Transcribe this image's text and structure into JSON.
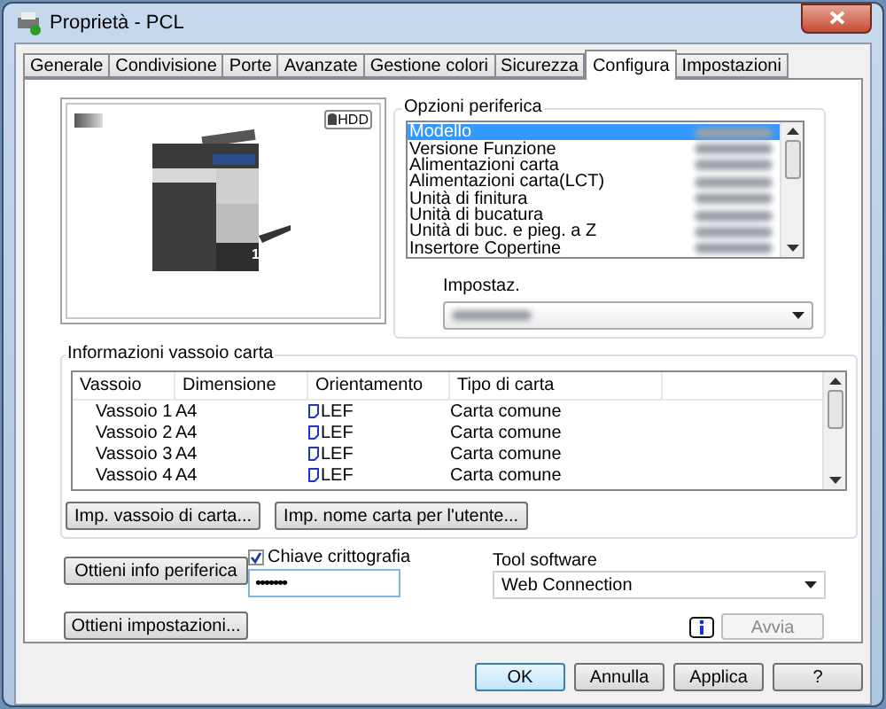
{
  "window": {
    "title": "Proprietà - PCL"
  },
  "tabs": [
    {
      "label": "Generale",
      "selected": false
    },
    {
      "label": "Condivisione",
      "selected": false
    },
    {
      "label": "Porte",
      "selected": false
    },
    {
      "label": "Avanzate",
      "selected": false
    },
    {
      "label": "Gestione colori",
      "selected": false
    },
    {
      "label": "Sicurezza",
      "selected": false
    },
    {
      "label": "Configura",
      "selected": true
    },
    {
      "label": "Impostazioni",
      "selected": false
    }
  ],
  "printer_preview": {
    "badge": "HDD",
    "tray_number": "1"
  },
  "device_options": {
    "title": "Opzioni periferica",
    "items": [
      {
        "label": "Modello",
        "selected": true
      },
      {
        "label": "Versione Funzione",
        "selected": false
      },
      {
        "label": "Alimentazioni carta",
        "selected": false
      },
      {
        "label": "Alimentazioni carta(LCT)",
        "selected": false
      },
      {
        "label": "Unità di finitura",
        "selected": false
      },
      {
        "label": "Unità di bucatura",
        "selected": false
      },
      {
        "label": "Unità di buc. e pieg. a Z",
        "selected": false
      },
      {
        "label": "Insertore Copertine",
        "selected": false
      }
    ],
    "setting_label": "Impostaz."
  },
  "tray_info": {
    "title": "Informazioni vassoio carta",
    "columns": [
      "Vassoio",
      "Dimensione",
      "Orientamento",
      "Tipo di carta"
    ],
    "rows": [
      {
        "tray": "Vassoio 1",
        "size": "A4",
        "orientation": "LEF",
        "paper_type": "Carta comune"
      },
      {
        "tray": "Vassoio 2",
        "size": "A4",
        "orientation": "LEF",
        "paper_type": "Carta comune"
      },
      {
        "tray": "Vassoio 3",
        "size": "A4",
        "orientation": "LEF",
        "paper_type": "Carta comune"
      },
      {
        "tray": "Vassoio 4",
        "size": "A4",
        "orientation": "LEF",
        "paper_type": "Carta comune"
      }
    ],
    "buttons": [
      "Imp. vassoio di carta...",
      "Imp. nome carta per l'utente..."
    ]
  },
  "get_info_button": "Ottieni info periferica",
  "encryption": {
    "label": "Chiave crittografia",
    "checked": true,
    "value": "•••••••"
  },
  "tool_software": {
    "label": "Tool software",
    "value": "Web Connection"
  },
  "get_settings_button": "Ottieni impostazioni...",
  "launch_button": {
    "label": "Avvia",
    "disabled": true
  },
  "dialog_buttons": [
    {
      "label": "OK",
      "default": true
    },
    {
      "label": "Annulla",
      "default": false
    },
    {
      "label": "Applica",
      "default": false
    },
    {
      "label": "?",
      "default": false
    }
  ]
}
